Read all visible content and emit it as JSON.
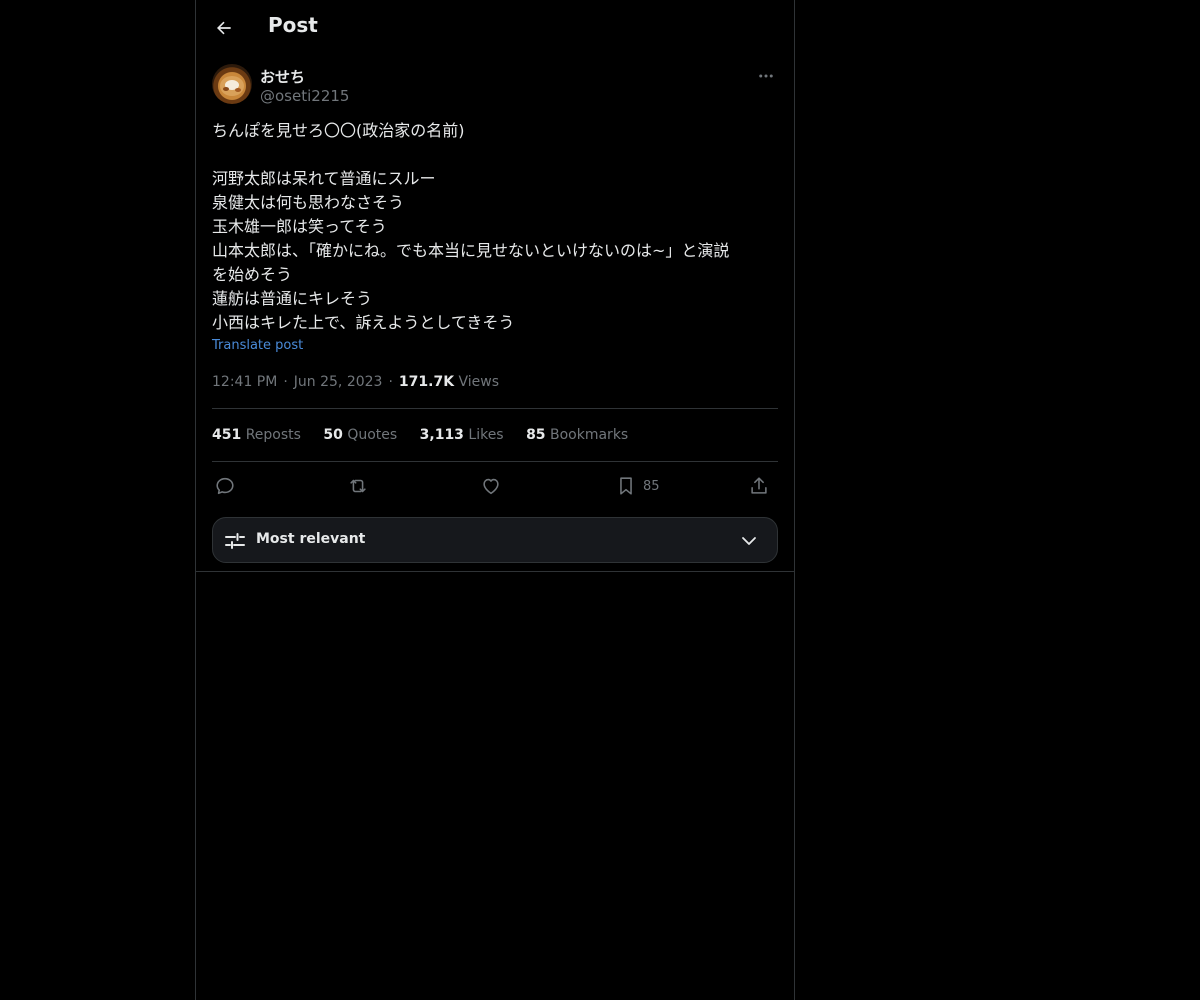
{
  "header": {
    "title": "Post",
    "back_icon": "arrow-left-icon"
  },
  "author": {
    "display_name": "おせち",
    "handle": "@oseti2215"
  },
  "post": {
    "lines": [
      "ちんぽを見せろ〇〇(政治家の名前)",
      "",
      "河野太郎は呆れて普通にスルー",
      "泉健太は何も思わなさそう",
      "玉木雄一郎は笑ってそう",
      "山本太郎は、「確かにね。でも本当に見せないといけないのは~」と演説",
      "を始めそう",
      "蓮舫は普通にキレそう",
      "小西はキレた上で、訴えようとしてきそう"
    ],
    "translate_label": "Translate post"
  },
  "meta": {
    "time": "12:41 PM",
    "date": "Jun 25, 2023",
    "views_count": "171.7K",
    "views_label": "Views"
  },
  "stats": [
    {
      "count": "451",
      "label": "Reposts"
    },
    {
      "count": "50",
      "label": "Quotes"
    },
    {
      "count": "3,113",
      "label": "Likes"
    },
    {
      "count": "85",
      "label": "Bookmarks"
    }
  ],
  "actions": {
    "bookmark_count": "85"
  },
  "sort": {
    "label": "Most relevant"
  },
  "colors": {
    "background": "#000000",
    "text": "#e7e9ea",
    "muted": "#71767b",
    "link": "#4a8bd9",
    "border": "#2f3336"
  }
}
